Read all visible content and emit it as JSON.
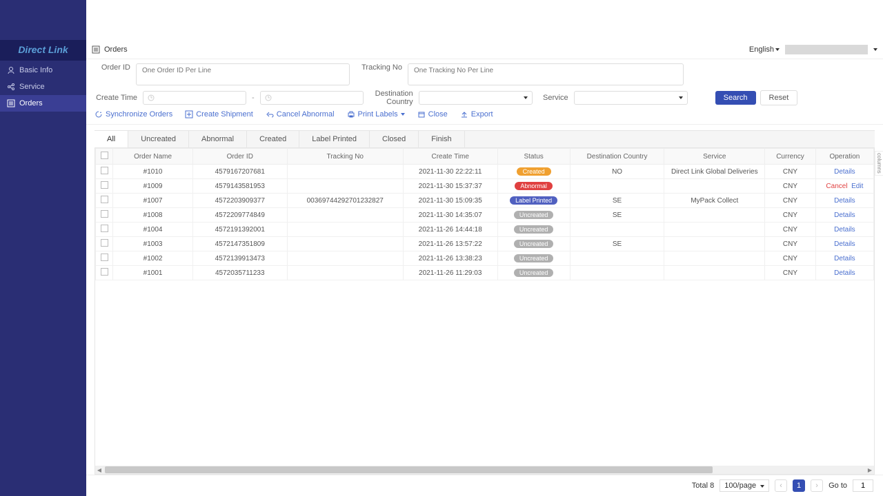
{
  "logo": "Direct Link",
  "sidebar": {
    "items": [
      {
        "label": "Basic Info",
        "icon": "user-icon"
      },
      {
        "label": "Service",
        "icon": "share-icon"
      },
      {
        "label": "Orders",
        "icon": "list-icon",
        "active": true
      }
    ]
  },
  "header": {
    "page_icon": "list-icon",
    "page_title": "Orders",
    "language": "English"
  },
  "filters": {
    "order_id_label": "Order ID",
    "order_id_placeholder": "One Order ID Per Line",
    "tracking_label": "Tracking No",
    "tracking_placeholder": "One Tracking No Per Line",
    "create_time_label": "Create Time",
    "dest_label": "Destination Country",
    "service_label": "Service",
    "search_btn": "Search",
    "reset_btn": "Reset"
  },
  "toolbar": {
    "sync": "Synchronize Orders",
    "create": "Create Shipment",
    "cancel": "Cancel Abnormal",
    "print": "Print Labels",
    "close": "Close",
    "export": "Export"
  },
  "tabs": [
    "All",
    "Uncreated",
    "Abnormal",
    "Created",
    "Label Printed",
    "Closed",
    "Finish"
  ],
  "active_tab": "All",
  "columns": [
    "",
    "Order Name",
    "Order ID",
    "Tracking No",
    "Create Time",
    "Status",
    "Destination Country",
    "Service",
    "Currency",
    "Operation"
  ],
  "columns_toggle": "columns",
  "rows": [
    {
      "name": "#1010",
      "oid": "4579167207681",
      "trk": "",
      "time": "2021-11-30 22:22:11",
      "status": "Created",
      "status_cls": "b-created",
      "dest": "NO",
      "svc": "Direct Link Global Deliveries",
      "cur": "CNY",
      "ops": [
        {
          "t": "Details",
          "cls": "link"
        }
      ]
    },
    {
      "name": "#1009",
      "oid": "4579143581953",
      "trk": "",
      "time": "2021-11-30 15:37:37",
      "status": "Abnormal",
      "status_cls": "b-abnormal",
      "dest": "",
      "svc": "",
      "cur": "CNY",
      "ops": [
        {
          "t": "Cancel",
          "cls": "link-danger"
        },
        {
          "t": "Edit",
          "cls": "link"
        }
      ]
    },
    {
      "name": "#1007",
      "oid": "4572203909377",
      "trk": "00369744292701232827",
      "time": "2021-11-30 15:09:35",
      "status": "Label Printed",
      "status_cls": "b-label",
      "dest": "SE",
      "svc": "MyPack Collect",
      "cur": "CNY",
      "ops": [
        {
          "t": "Details",
          "cls": "link"
        }
      ]
    },
    {
      "name": "#1008",
      "oid": "4572209774849",
      "trk": "",
      "time": "2021-11-30 14:35:07",
      "status": "Uncreated",
      "status_cls": "b-uncreated",
      "dest": "SE",
      "svc": "",
      "cur": "CNY",
      "ops": [
        {
          "t": "Details",
          "cls": "link"
        }
      ]
    },
    {
      "name": "#1004",
      "oid": "4572191392001",
      "trk": "",
      "time": "2021-11-26 14:44:18",
      "status": "Uncreated",
      "status_cls": "b-uncreated",
      "dest": "",
      "svc": "",
      "cur": "CNY",
      "ops": [
        {
          "t": "Details",
          "cls": "link"
        }
      ]
    },
    {
      "name": "#1003",
      "oid": "4572147351809",
      "trk": "",
      "time": "2021-11-26 13:57:22",
      "status": "Uncreated",
      "status_cls": "b-uncreated",
      "dest": "SE",
      "svc": "",
      "cur": "CNY",
      "ops": [
        {
          "t": "Details",
          "cls": "link"
        }
      ]
    },
    {
      "name": "#1002",
      "oid": "4572139913473",
      "trk": "",
      "time": "2021-11-26 13:38:23",
      "status": "Uncreated",
      "status_cls": "b-uncreated",
      "dest": "",
      "svc": "",
      "cur": "CNY",
      "ops": [
        {
          "t": "Details",
          "cls": "link"
        }
      ]
    },
    {
      "name": "#1001",
      "oid": "4572035711233",
      "trk": "",
      "time": "2021-11-26 11:29:03",
      "status": "Uncreated",
      "status_cls": "b-uncreated",
      "dest": "",
      "svc": "",
      "cur": "CNY",
      "ops": [
        {
          "t": "Details",
          "cls": "link"
        }
      ]
    }
  ],
  "pager": {
    "total_label": "Total 8",
    "page_size": "100/page",
    "current": "1",
    "goto_label": "Go to",
    "goto_value": "1"
  }
}
